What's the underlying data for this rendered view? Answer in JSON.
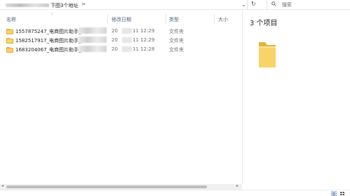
{
  "address_bar": {
    "current_folder": "下图3个地址",
    "separator": ">",
    "dropdown_glyph": "⌄",
    "refresh_glyph": "↻"
  },
  "search": {
    "placeholder": "搜索"
  },
  "columns": {
    "name": "名称",
    "date_modified": "修改日期",
    "type": "类型",
    "size": "大小"
  },
  "files": [
    {
      "name": "1557875247_电商图片助手_",
      "date_prefix": "20",
      "date_rest": "11 12:29",
      "type": "文件夹"
    },
    {
      "name": "1582517917_电商图片助手_",
      "date_prefix": "20",
      "date_rest": "11 12:29",
      "type": "文件夹"
    },
    {
      "name": "1683204067_电商图片助手_",
      "date_prefix": "20",
      "date_rest": "11 12:28",
      "type": "文件夹"
    }
  ],
  "details_pane": {
    "title": "3 个项目"
  },
  "scrollbar": {
    "left_arrow": "◂",
    "right_arrow": "▸"
  },
  "colors": {
    "folder_fill": "#f8d36a",
    "folder_tab": "#e7b43b",
    "header_text": "#4c607a",
    "secondary_text": "#6b6b6b"
  }
}
